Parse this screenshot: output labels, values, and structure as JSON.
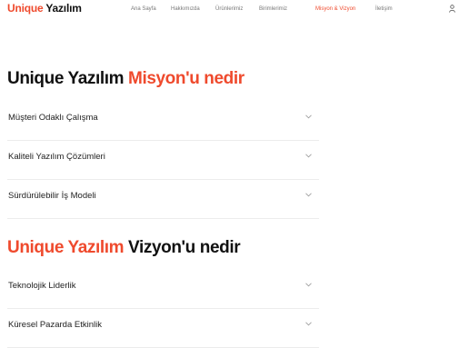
{
  "header": {
    "logo_part1": "Unique",
    "logo_part2": "Yazılım",
    "nav": [
      {
        "label": "Ana Sayfa"
      },
      {
        "label": "Hakkımızda"
      },
      {
        "label": "Ürünlerimiz"
      },
      {
        "label": "Birimlerimiz"
      },
      {
        "label": "Misyon & Vizyon",
        "active": true
      },
      {
        "label": "İletişim"
      }
    ],
    "user_icon": "user-icon"
  },
  "mission": {
    "title_dark": "Unique Yazılım",
    "title_accent": "Misyon'u nedir",
    "items": [
      {
        "label": "Müşteri Odaklı Çalışma"
      },
      {
        "label": "Kaliteli Yazılım Çözümleri"
      },
      {
        "label": "Sürdürülebilir İş Modeli"
      }
    ]
  },
  "vision": {
    "title_accent": "Unique Yazılım",
    "title_dark": "Vizyon'u nedir",
    "items": [
      {
        "label": "Teknolojik Liderlik"
      },
      {
        "label": "Küresel Pazarda Etkinlik"
      }
    ]
  },
  "colors": {
    "accent": "#ef4a2d",
    "text": "#111111",
    "divider": "#ececec"
  }
}
